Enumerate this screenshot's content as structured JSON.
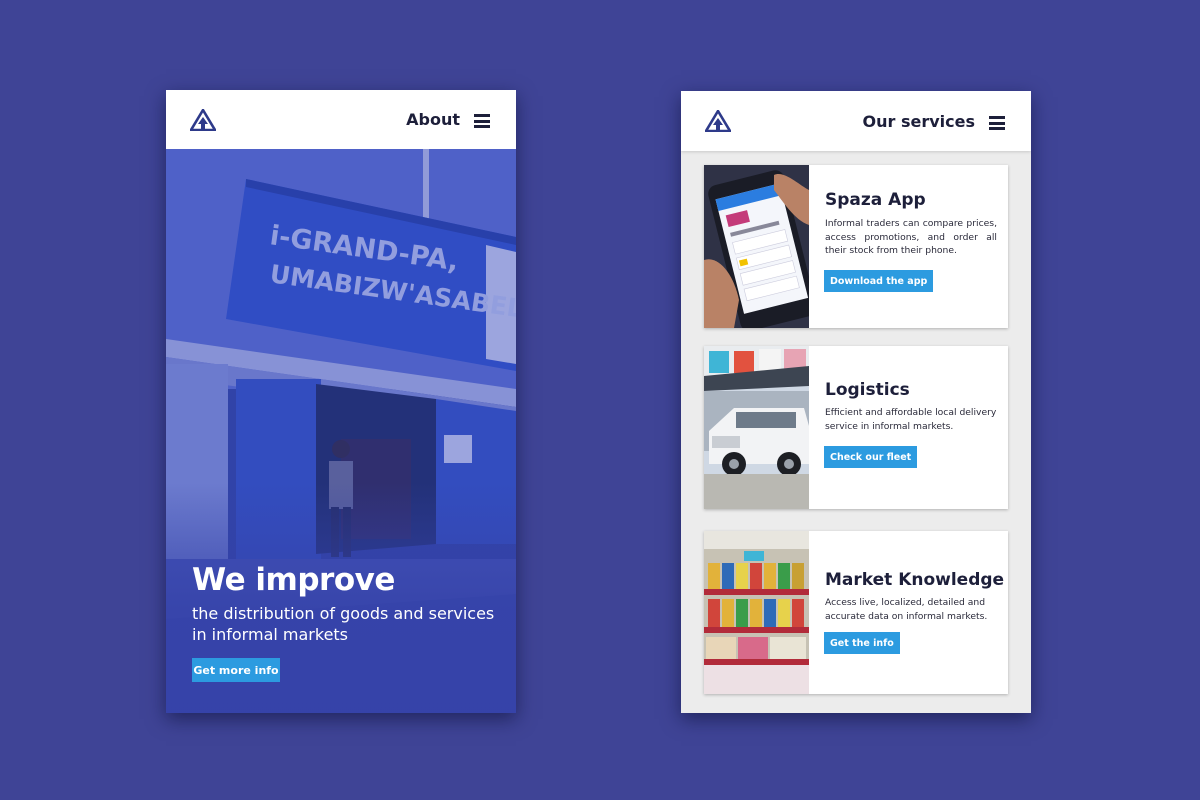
{
  "about_screen": {
    "nav": {
      "title": "About",
      "logo_icon": "triangle-arrow-logo-icon",
      "menu_icon": "hamburger-menu-icon"
    },
    "hero": {
      "sign_line_1": "i-GRAND-PA,",
      "sign_line_2": "UMABIZW'ASABELE.",
      "title": "We improve",
      "subtitle": "the distribution of goods and services in informal markets",
      "button_label": "Get more info"
    }
  },
  "services_screen": {
    "nav": {
      "title": "Our services",
      "logo_icon": "triangle-arrow-logo-icon",
      "menu_icon": "hamburger-menu-icon"
    },
    "services": [
      {
        "title": "Spaza App",
        "description": "Informal traders can compare prices, access promotions, and order all their stock from their phone.",
        "button_label": "Download the app",
        "image": "phone-app-photo"
      },
      {
        "title": "Logistics",
        "description": "Efficient and affordable local delivery service in informal markets.",
        "button_label": "Check our fleet",
        "image": "delivery-truck-photo"
      },
      {
        "title": "Market Knowledge",
        "description": "Access live, localized, detailed and accurate data on informal markets.",
        "button_label": "Get the info",
        "image": "store-shelves-photo"
      }
    ]
  },
  "colors": {
    "background": "#3f4496",
    "accent_button": "#2c9be0",
    "heading_text": "#1d1f3a"
  }
}
